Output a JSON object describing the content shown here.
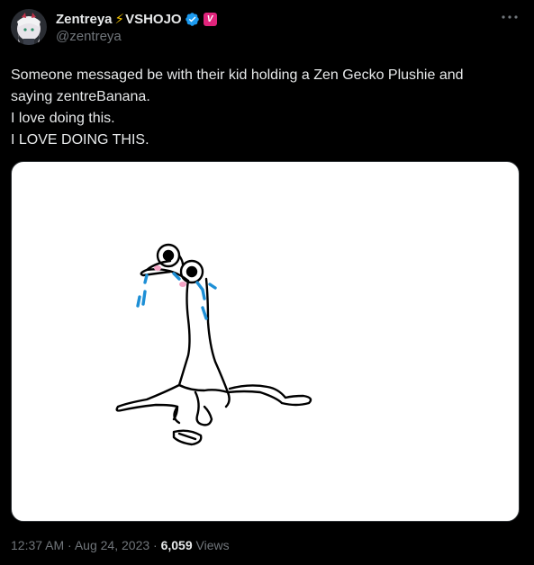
{
  "author": {
    "display_name": "Zentreya",
    "org_name": "VSHOJO",
    "org_badge_letter": "V",
    "handle": "@zentreya",
    "bolt_icon": "lightning-bolt-icon",
    "verified_icon": "verified-check-icon"
  },
  "tweet": {
    "lines": [
      "Someone messaged be with their kid holding a Zen Gecko Plushie and",
      "saying zentreBanana.",
      "I love doing this.",
      "I LOVE DOING THIS."
    ]
  },
  "meta": {
    "time": "12:37 AM",
    "separator": "·",
    "date": "Aug 24, 2023",
    "views_count": "6,059",
    "views_label": "Views"
  },
  "colors": {
    "background": "#000000",
    "text": "#e7e9ea",
    "muted": "#71767b",
    "verified": "#1d9bf0",
    "bolt": "#f5c400",
    "org_badge": "#e0247c",
    "tears": "#1d8fd6",
    "blush": "#f4a3c4"
  }
}
